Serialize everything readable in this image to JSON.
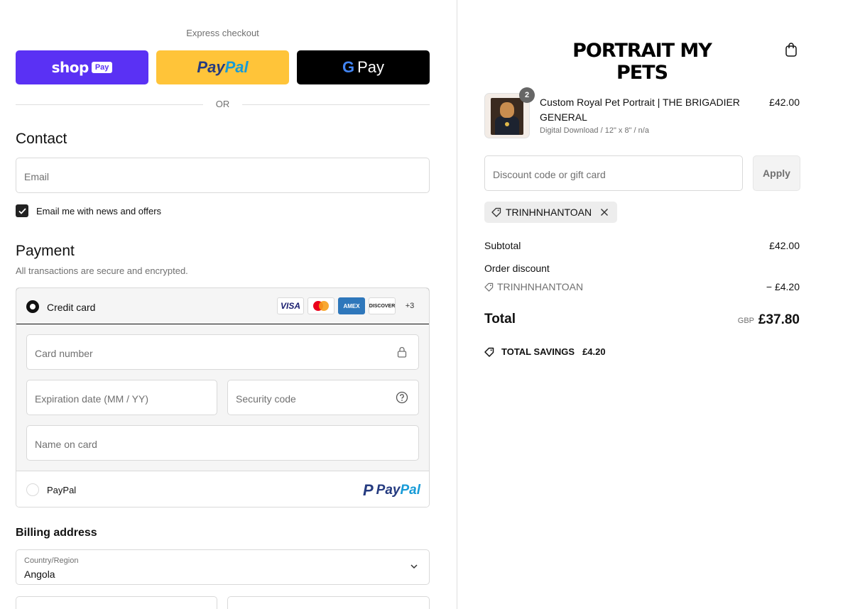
{
  "express": {
    "label": "Express checkout",
    "shop_word": "shop",
    "shop_pay": "Pay",
    "paypal_a": "Pay",
    "paypal_b": "Pal",
    "gpay_g": "G",
    "gpay_word": "Pay",
    "or": "OR"
  },
  "contact": {
    "heading": "Contact",
    "email_placeholder": "Email",
    "newsletter_label": "Email me with news and offers",
    "newsletter_checked": true
  },
  "payment": {
    "heading": "Payment",
    "note": "All transactions are secure and encrypted.",
    "credit_card_label": "Credit card",
    "card_brands": [
      "VISA",
      "Mastercard",
      "AMEX",
      "DISCOVER"
    ],
    "more_cards": "+3",
    "card_number_placeholder": "Card number",
    "expiration_placeholder": "Expiration date (MM / YY)",
    "security_placeholder": "Security code",
    "name_placeholder": "Name on card",
    "paypal_label": "PayPal",
    "paypal_logo_a": "Pay",
    "paypal_logo_b": "Pal"
  },
  "billing": {
    "heading": "Billing address",
    "country_label": "Country/Region",
    "country_value": "Angola"
  },
  "store": {
    "title": "PORTRAIT MY PETS"
  },
  "cart": {
    "item": {
      "name": "Custom Royal Pet Portrait | THE BRIGADIER GENERAL",
      "variant": "Digital Download / 12\" x 8\" / n/a",
      "price": "£42.00",
      "quantity": "2"
    },
    "discount_placeholder": "Discount code or gift card",
    "apply_label": "Apply",
    "applied_code": "TRINHNHANTOAN"
  },
  "summary": {
    "subtotal_label": "Subtotal",
    "subtotal_value": "£42.00",
    "order_discount_label": "Order discount",
    "discount_code": "TRINHNHANTOAN",
    "discount_value": "− £4.20",
    "total_label": "Total",
    "currency": "GBP",
    "total_value": "£37.80",
    "savings_label": "TOTAL SAVINGS",
    "savings_value": "£4.20"
  },
  "colors": {
    "shop_pay": "#5a31f4",
    "paypal_yellow": "#ffc439",
    "gpay_black": "#000000",
    "border": "#d9d9d9",
    "muted_text": "#707070"
  }
}
